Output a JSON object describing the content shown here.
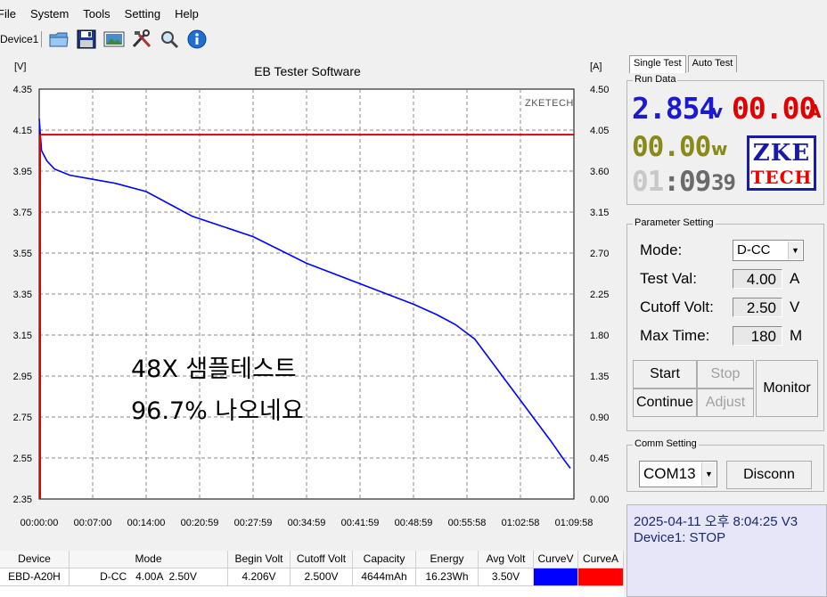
{
  "menu": [
    "File",
    "System",
    "Tools",
    "Setting",
    "Help"
  ],
  "toolbar": {
    "device_tab": "Device1",
    "buttons": [
      "open-folder-icon",
      "save-icon",
      "image-icon",
      "tools-icon",
      "search-icon",
      "info-icon"
    ]
  },
  "chart": {
    "title": "EB Tester Software",
    "left_unit": "[V]",
    "right_unit": "[A]",
    "watermark": "ZKETECH",
    "annotation_line1": "48X 샘플테스트",
    "annotation_line2": "96.7% 나오네요"
  },
  "chart_data": {
    "type": "line",
    "title": "EB Tester Software",
    "ylabel": "[V]",
    "y2label": "[A]",
    "ylim": [
      2.35,
      4.35
    ],
    "y2lim": [
      0.0,
      4.5
    ],
    "y_ticks": [
      "4.35",
      "4.15",
      "3.95",
      "3.75",
      "3.55",
      "3.35",
      "3.15",
      "2.95",
      "2.75",
      "2.55",
      "2.35"
    ],
    "y2_ticks": [
      "4.50",
      "4.05",
      "3.60",
      "3.15",
      "2.70",
      "2.25",
      "1.80",
      "1.35",
      "0.90",
      "0.45",
      "0.00"
    ],
    "x_ticks": [
      "00:00:00",
      "00:07:00",
      "00:14:00",
      "00:20:59",
      "00:27:59",
      "00:34:59",
      "00:41:59",
      "00:48:59",
      "00:55:58",
      "01:02:58",
      "01:09:58"
    ],
    "grid": true,
    "series": [
      {
        "name": "CurveV",
        "color": "#0000ff",
        "x_min": [
          0,
          0.3,
          1,
          2,
          4,
          7,
          10,
          14,
          20,
          28,
          35,
          42,
          49,
          52,
          54.5,
          57,
          59,
          61,
          63,
          65,
          67,
          68.5,
          69.5
        ],
        "y": [
          4.206,
          4.05,
          4.0,
          3.96,
          3.93,
          3.91,
          3.89,
          3.85,
          3.73,
          3.63,
          3.5,
          3.4,
          3.3,
          3.25,
          3.2,
          3.13,
          3.03,
          2.93,
          2.83,
          2.73,
          2.63,
          2.55,
          2.5
        ]
      },
      {
        "name": "CurveA",
        "color": "#e00000",
        "x_min": [
          0,
          69.5
        ],
        "y_amps": [
          4.0,
          4.0
        ]
      }
    ]
  },
  "tabs": [
    "Single Test",
    "Auto Test"
  ],
  "run_data": {
    "label": "Run Data",
    "voltage": "2.854",
    "voltage_unit": "v",
    "current": "00.00",
    "current_unit": "A",
    "power": "00.00",
    "power_unit": "w",
    "time_h": "01",
    "time_m": "09",
    "time_s": "39",
    "logo_top": "ZKE",
    "logo_bottom": "TECH"
  },
  "parameter": {
    "label": "Parameter Setting",
    "mode_label": "Mode:",
    "mode_value": "D-CC",
    "test_val_label": "Test Val:",
    "test_val": "4.00",
    "test_val_unit": "A",
    "cutoff_label": "Cutoff Volt:",
    "cutoff_val": "2.50",
    "cutoff_unit": "V",
    "max_time_label": "Max Time:",
    "max_time_val": "180",
    "max_time_unit": "M",
    "start": "Start",
    "stop": "Stop",
    "continue": "Continue",
    "adjust": "Adjust",
    "monitor": "Monitor"
  },
  "comm": {
    "label": "Comm Setting",
    "port": "COM13",
    "disconnect": "Disconn"
  },
  "status": {
    "line1": "2025-04-11 오후 8:04:25  V3",
    "line2": "Device1: STOP"
  },
  "table": {
    "headers": [
      "Device",
      "Mode",
      "Begin Volt",
      "Cutoff Volt",
      "Capacity",
      "Energy",
      "Avg Volt",
      "CurveV",
      "CurveA"
    ],
    "row": [
      "EBD-A20H",
      "D-CC   4.00A  2.50V",
      "4.206V",
      "2.500V",
      "4644mAh",
      "16.23Wh",
      "3.50V",
      "",
      ""
    ],
    "curve_colors": [
      "#0000ff",
      "#ff0000"
    ]
  }
}
